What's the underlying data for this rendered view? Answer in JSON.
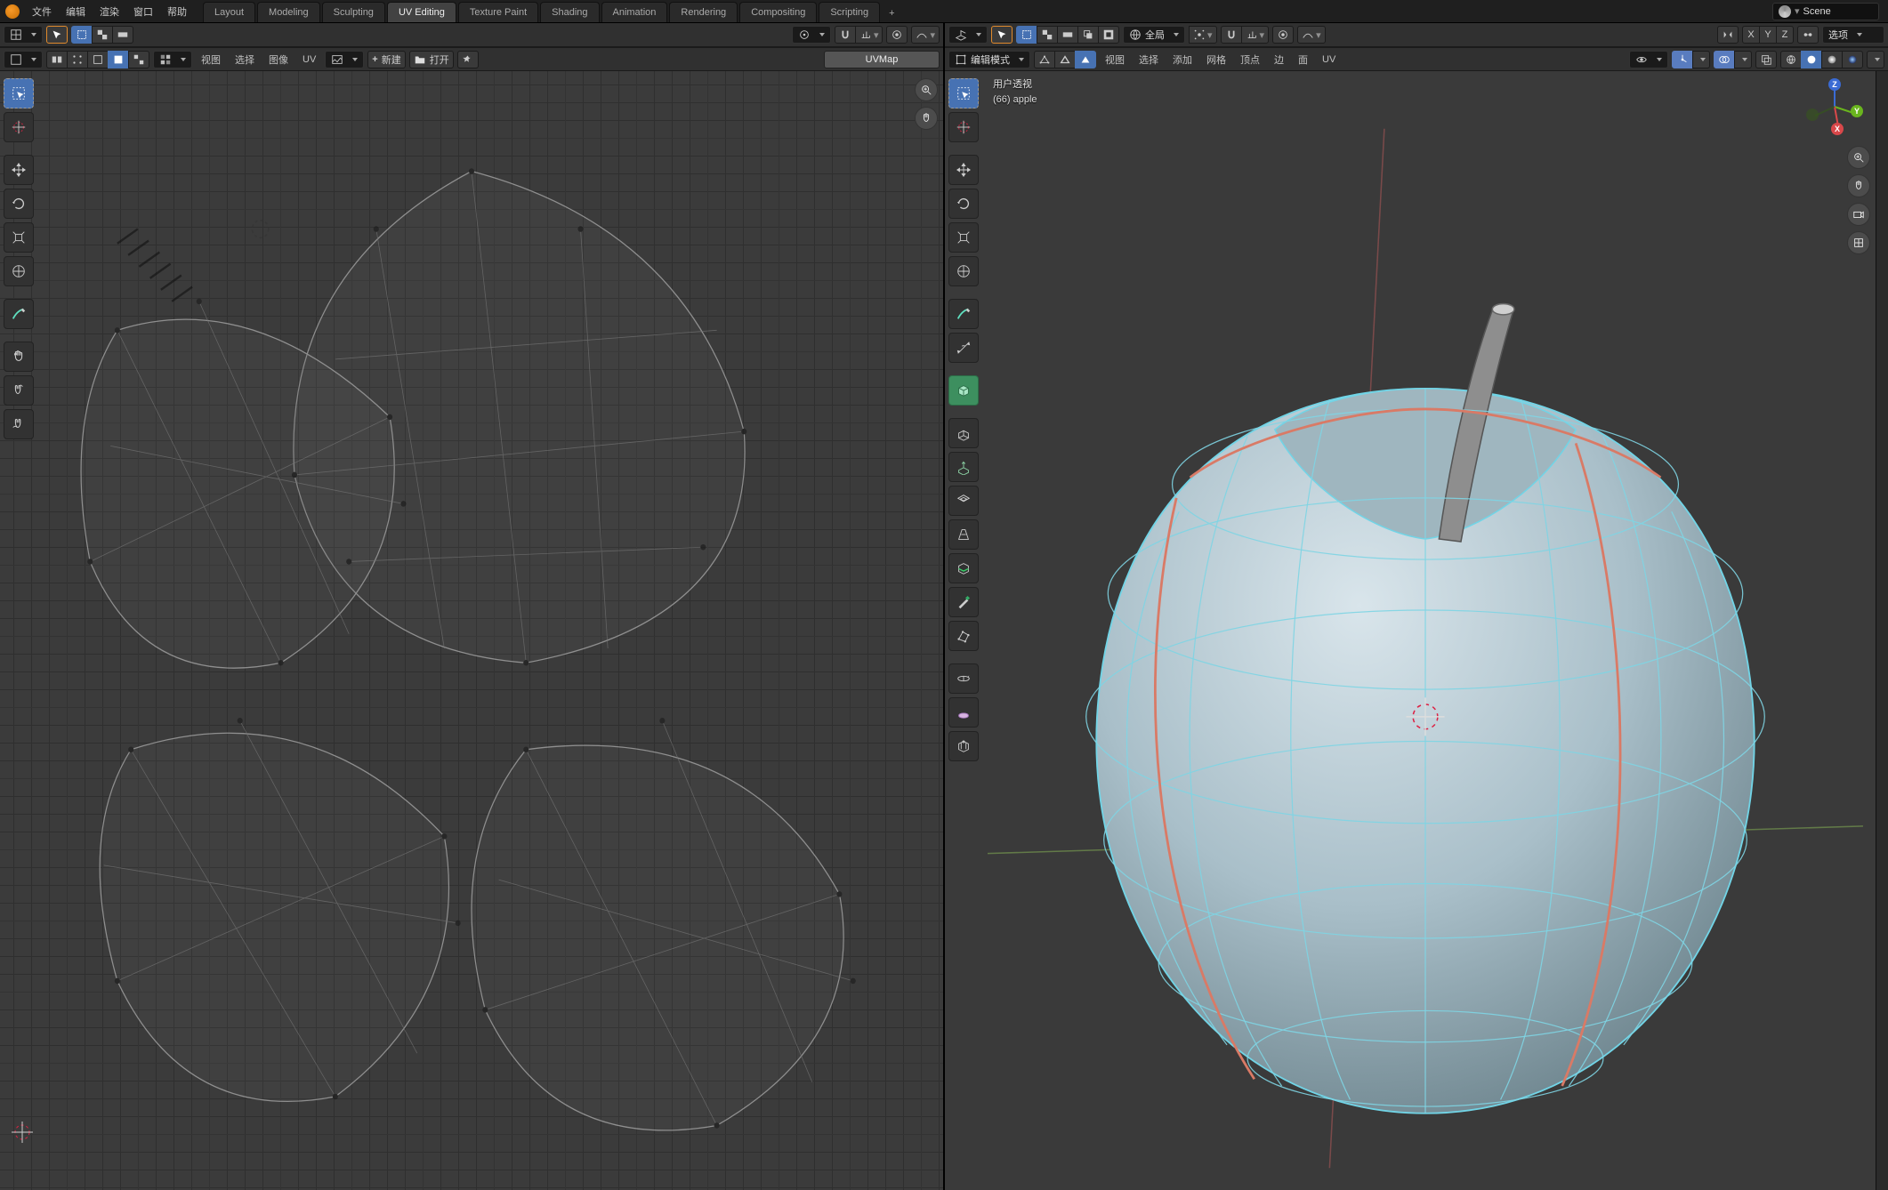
{
  "topmenu": {
    "items": [
      "文件",
      "编辑",
      "渲染",
      "窗口",
      "帮助"
    ]
  },
  "workspaces": {
    "tabs": [
      {
        "label": "Layout",
        "active": false
      },
      {
        "label": "Modeling",
        "active": false
      },
      {
        "label": "Sculpting",
        "active": false
      },
      {
        "label": "UV Editing",
        "active": true
      },
      {
        "label": "Texture Paint",
        "active": false
      },
      {
        "label": "Shading",
        "active": false
      },
      {
        "label": "Animation",
        "active": false
      },
      {
        "label": "Rendering",
        "active": false
      },
      {
        "label": "Compositing",
        "active": false
      },
      {
        "label": "Scripting",
        "active": false
      }
    ],
    "add_label": "+"
  },
  "scene": {
    "label": "Scene"
  },
  "uv_editor": {
    "header_menus": [
      "视图",
      "选择",
      "图像",
      "UV"
    ],
    "new_label": "新建",
    "open_label": "打开",
    "uvmap_name": "UVMap",
    "tools": [
      "select",
      "cursor",
      "move",
      "rotate",
      "scale",
      "transform",
      "annotate",
      "grab",
      "pinch",
      "relax"
    ]
  },
  "view3d": {
    "mode_label": "编辑模式",
    "orientation_label": "全局",
    "header_menus": [
      "视图",
      "选择",
      "添加",
      "网格",
      "顶点",
      "边",
      "面",
      "UV"
    ],
    "options_label": "选项",
    "axis_labels": [
      "X",
      "Y",
      "Z"
    ],
    "overlay": {
      "perspective": "用户透视",
      "object": "(66) apple"
    },
    "gizmo": {
      "x": "X",
      "y": "Y",
      "z": "Z"
    },
    "colors": {
      "x": "#d9484a",
      "y": "#6ab51e",
      "z": "#3a6bd4"
    }
  }
}
